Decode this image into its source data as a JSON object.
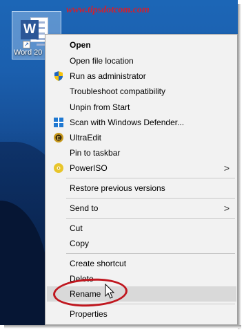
{
  "watermark": "www.tipsdotcom.com",
  "desktop_icon": {
    "label": "Word 20",
    "letter": "W"
  },
  "menu": {
    "items": [
      {
        "label": "Open",
        "bold": true
      },
      {
        "label": "Open file location"
      },
      {
        "label": "Run as administrator",
        "icon": "uac-shield-icon"
      },
      {
        "label": "Troubleshoot compatibility"
      },
      {
        "label": "Unpin from Start"
      },
      {
        "label": "Scan with Windows Defender...",
        "icon": "windows-defender-icon"
      },
      {
        "label": "UltraEdit",
        "icon": "ultraedit-icon"
      },
      {
        "label": "Pin to taskbar"
      },
      {
        "label": "PowerISO",
        "icon": "poweriso-icon",
        "submenu": true
      },
      {
        "label": "Restore previous versions"
      },
      {
        "label": "Send to",
        "submenu": true
      },
      {
        "label": "Cut"
      },
      {
        "label": "Copy"
      },
      {
        "label": "Create shortcut"
      },
      {
        "label": "Delete"
      },
      {
        "label": "Rename",
        "highlighted": true
      },
      {
        "label": "Properties"
      }
    ],
    "submenu_glyph": ">"
  },
  "colors": {
    "highlight_ring": "#c0171f",
    "watermark": "#d81e2a",
    "menu_bg": "#f2f2f2",
    "hover_bg": "#d9d9d9"
  }
}
